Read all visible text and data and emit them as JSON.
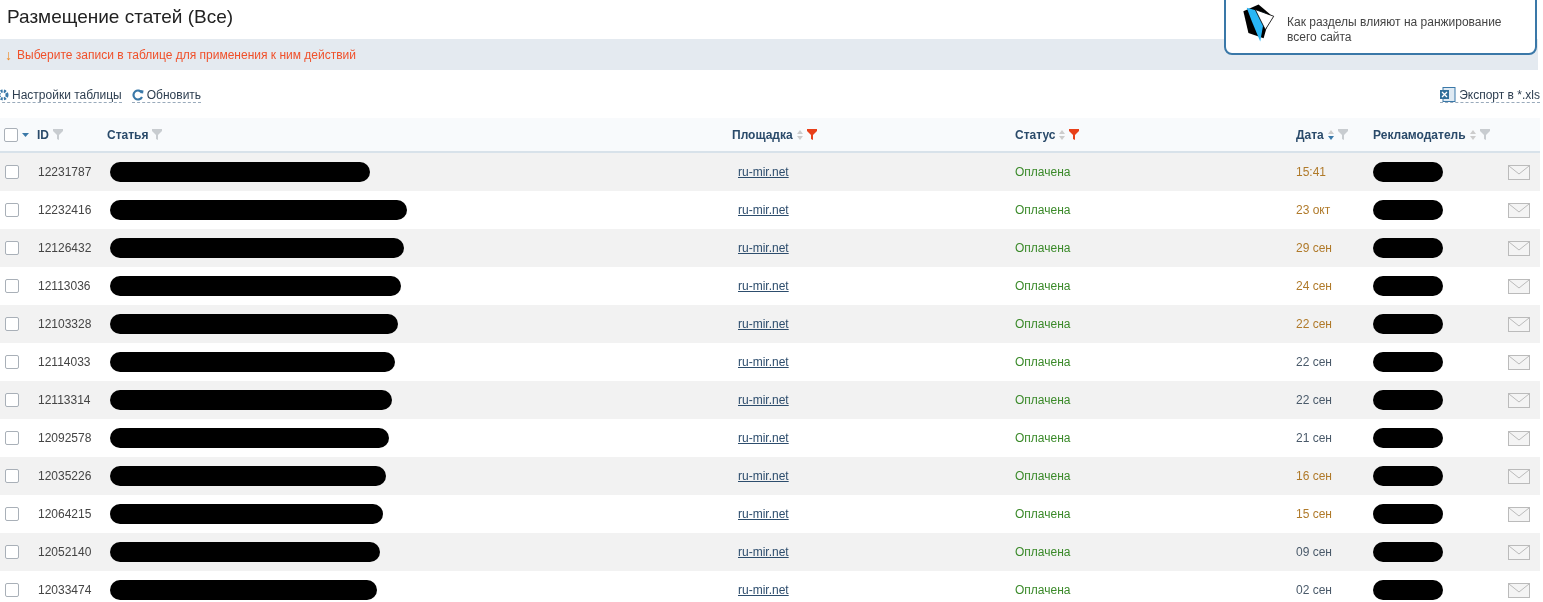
{
  "title": "Размещение статей (Все)",
  "notice": {
    "text": "Как разделы влияют на ранжирование всего сайта"
  },
  "hint": {
    "arrow": "↓",
    "text": "Выберите записи в таблице для применения к ним действий"
  },
  "toolbar": {
    "settings": "Настройки таблицы",
    "refresh": "Обновить",
    "export": "Экспорт в *.xls"
  },
  "table": {
    "select_all": {
      "checked": false
    },
    "columns": [
      {
        "label": "ID",
        "sortable": false,
        "filter_active": false
      },
      {
        "label": "Статья",
        "sortable": false,
        "filter_active": false
      },
      {
        "label": "Площадка",
        "sorted": false,
        "sortable": true,
        "filter_active": true
      },
      {
        "label": "Статус",
        "sorted": false,
        "sortable": true,
        "filter_active": true
      },
      {
        "label": "Дата",
        "sorted": true,
        "sortable": true,
        "filter_active": false
      },
      {
        "label": "Рекламодатель",
        "sorted": false,
        "sortable": true,
        "filter_active": false
      }
    ],
    "rows": [
      {
        "checked": false,
        "id": "12231787",
        "platform": "ru-mir.net",
        "status": "Оплачена",
        "date": "15:41",
        "color": "#b07a2a"
      },
      {
        "checked": false,
        "id": "12232416",
        "platform": "ru-mir.net",
        "status": "Оплачена",
        "date": "23 окт",
        "color": "#b07a2a"
      },
      {
        "checked": false,
        "id": "12126432",
        "platform": "ru-mir.net",
        "status": "Оплачена",
        "date": "29 сен",
        "color": "#b07a2a"
      },
      {
        "checked": false,
        "id": "12113036",
        "platform": "ru-mir.net",
        "status": "Оплачена",
        "date": "24 сен",
        "color": "#b07a2a"
      },
      {
        "checked": false,
        "id": "12103328",
        "platform": "ru-mir.net",
        "status": "Оплачена",
        "date": "22 сен",
        "color": "#b07a2a"
      },
      {
        "checked": false,
        "id": "12114033",
        "platform": "ru-mir.net",
        "status": "Оплачена",
        "date": "22 сен",
        "color": "#4a5a6a"
      },
      {
        "checked": false,
        "id": "12113314",
        "platform": "ru-mir.net",
        "status": "Оплачена",
        "date": "22 сен",
        "color": "#4a5a6a"
      },
      {
        "checked": false,
        "id": "12092578",
        "platform": "ru-mir.net",
        "status": "Оплачена",
        "date": "21 сен",
        "color": "#4a5a6a"
      },
      {
        "checked": false,
        "id": "12035226",
        "platform": "ru-mir.net",
        "status": "Оплачена",
        "date": "16 сен",
        "color": "#b07a2a"
      },
      {
        "checked": false,
        "id": "12064215",
        "platform": "ru-mir.net",
        "status": "Оплачена",
        "date": "15 сен",
        "color": "#b07a2a"
      },
      {
        "checked": false,
        "id": "12052140",
        "platform": "ru-mir.net",
        "status": "Оплачена",
        "date": "09 сен",
        "color": "#4a5a6a"
      },
      {
        "checked": false,
        "id": "12033474",
        "platform": "ru-mir.net",
        "status": "Оплачена",
        "date": "02 сен",
        "color": "#4a5a6a"
      }
    ]
  }
}
